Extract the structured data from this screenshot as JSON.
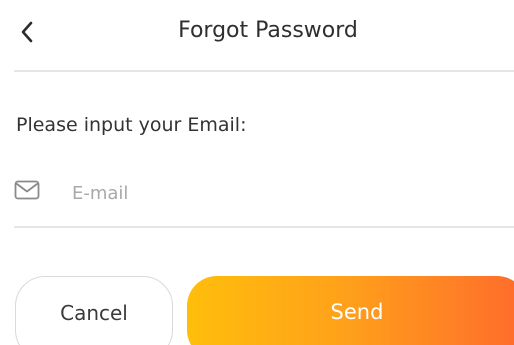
{
  "header": {
    "title": "Forgot Password",
    "back_icon": "chevron-left-icon"
  },
  "form": {
    "prompt": "Please input your Email:",
    "email": {
      "icon": "mail-icon",
      "placeholder": "E-mail",
      "value": ""
    }
  },
  "actions": {
    "cancel_label": "Cancel",
    "send_label": "Send"
  },
  "colors": {
    "send_gradient_start": "#ffbe0b",
    "send_gradient_end": "#ff6a2c",
    "divider": "#e6e6e6",
    "placeholder": "#a9a9a9"
  }
}
